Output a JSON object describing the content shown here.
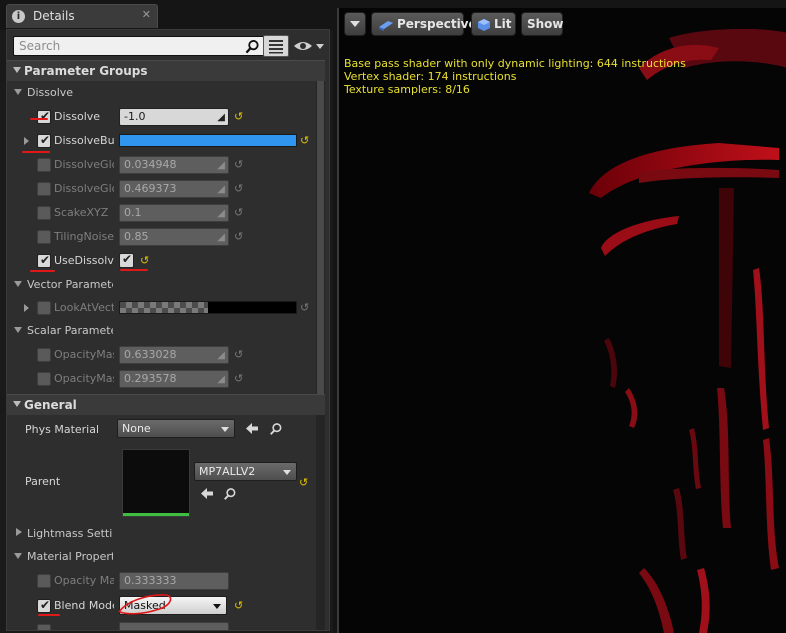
{
  "details": {
    "tab_title": "Details",
    "close_glyph": "✕",
    "search_placeholder": "Search",
    "categories": {
      "parameter_groups": "Parameter Groups",
      "general": "General"
    },
    "groups": {
      "dissolve": "Dissolve",
      "vector": "Vector Paramete",
      "scalar": "Scalar Paramete",
      "lightmass": "Lightmass Settin",
      "material_props": "Material Propert"
    },
    "params": [
      {
        "label": "Dissolve",
        "value": "-1.0",
        "enabled": true
      },
      {
        "label": "DissolveBur",
        "value": "",
        "enabled": true
      },
      {
        "label": "DissolveGlo",
        "value": "0.034948",
        "enabled": false
      },
      {
        "label": "DissolveGlo",
        "value": "0.469373",
        "enabled": false
      },
      {
        "label": "ScakeXYZ",
        "value": "0.1",
        "enabled": false
      },
      {
        "label": "TilingNoise",
        "value": "0.85",
        "enabled": false
      },
      {
        "label": "UseDissolve",
        "value": "",
        "enabled": true
      },
      {
        "label": "LookAtVect",
        "value": "",
        "enabled": false
      },
      {
        "label": "OpacityMas",
        "value": "0.633028",
        "enabled": false
      },
      {
        "label": "OpacityMas",
        "value": "0.293578",
        "enabled": false
      }
    ],
    "general": {
      "phys_material_label": "Phys Material",
      "phys_material_value": "None",
      "parent_label": "Parent",
      "parent_value": "MP7ALLV2",
      "opacity_label": "Opacity Ma",
      "opacity_value": "0.333333",
      "blend_mode_label": "Blend Mode",
      "blend_mode_value": "Masked"
    }
  },
  "viewport": {
    "perspective_label": "Perspective",
    "lit_label": "Lit",
    "show_label": "Show",
    "stats": [
      "Base pass shader with only dynamic lighting: 644 instructions",
      "Vertex shader: 174 instructions",
      "Texture samplers: 8/16"
    ]
  },
  "colors": {
    "accent_blue": "#2f95ef",
    "reset_yellow": "#e0c000",
    "stats_yellow": "#e8e030",
    "annotation_red": "#e01818",
    "mesh_red": "#c0101a"
  }
}
